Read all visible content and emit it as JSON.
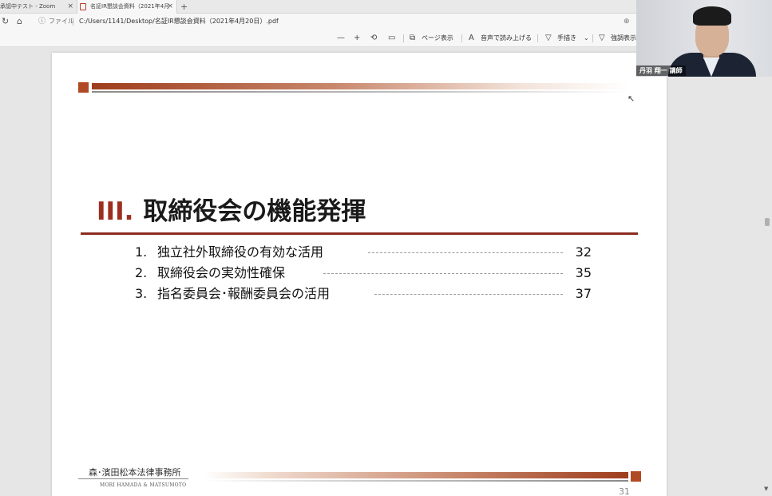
{
  "browser": {
    "tabs": [
      {
        "title": "承認中テスト - Zoom",
        "close": "×"
      },
      {
        "title": "名証IR懇談会資料（2021年4月",
        "close": "×"
      }
    ],
    "new_tab": "+"
  },
  "address": {
    "label": "ファイル",
    "url": "C:/Users/1141/Desktop/名証IR懇談会資料（2021年4月20日）.pdf"
  },
  "pdf_toolbar": {
    "zoom_out": "—",
    "zoom_in": "+",
    "page_view": "ページ表示",
    "read_aloud": "音声で読み上げる",
    "draw": "手描き",
    "highlight": "強調表示"
  },
  "slide": {
    "section_number": "III.",
    "section_title": "取締役会の機能発揮",
    "toc": [
      {
        "n": "1.",
        "title": "独立社外取締役の有効な活用",
        "page": "32"
      },
      {
        "n": "2.",
        "title": "取締役会の実効性確保",
        "page": "35"
      },
      {
        "n": "3.",
        "title": "指名委員会･報酬委員会の活用",
        "page": "37"
      }
    ],
    "logo_jp": "森･濱田松本法律事務所",
    "logo_en": "MORI HAMADA & MATSUMOTO",
    "page_number": "31",
    "colors": {
      "accent": "#9c2f1f",
      "bar": "#b04a24"
    }
  },
  "video": {
    "participant_name": "丹羽 翔一 講師"
  }
}
